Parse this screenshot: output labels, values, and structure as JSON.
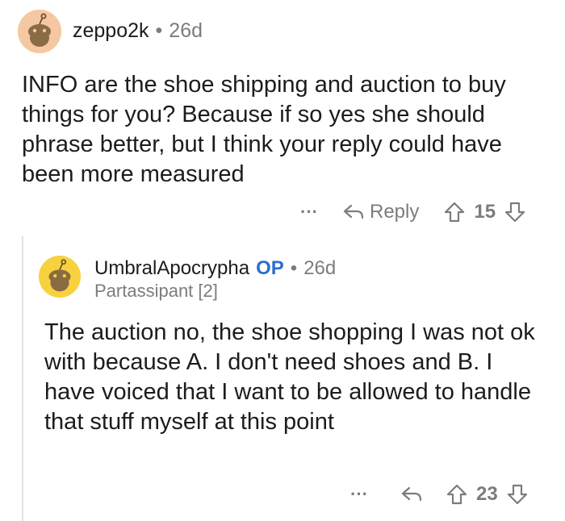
{
  "comment1": {
    "username": "zeppo2k",
    "separator": "•",
    "age": "26d",
    "body": "INFO are the shoe shipping and auction to buy things for you?  Because if so yes she should phrase better, but I think your reply could have been more measured",
    "more_label": "···",
    "reply_label": "Reply",
    "score": "15",
    "avatar_color": "#f5c8a2"
  },
  "comment2": {
    "username": "UmbralApocrypha",
    "op_badge": "OP",
    "separator": "•",
    "age": "26d",
    "flair": "Partassipant [2]",
    "body": "The auction no, the shoe shopping I was not ok with because A. I don't need shoes and B. I have voiced that I want to be allowed to handle that stuff myself at this point",
    "more_label": "···",
    "score": "23",
    "avatar_color": "#f7d23e"
  },
  "colors": {
    "text": "#1c1c1c",
    "muted": "#7c7c7c",
    "op_blue": "#2b6ed1",
    "thread_line": "#e4e4e4"
  }
}
